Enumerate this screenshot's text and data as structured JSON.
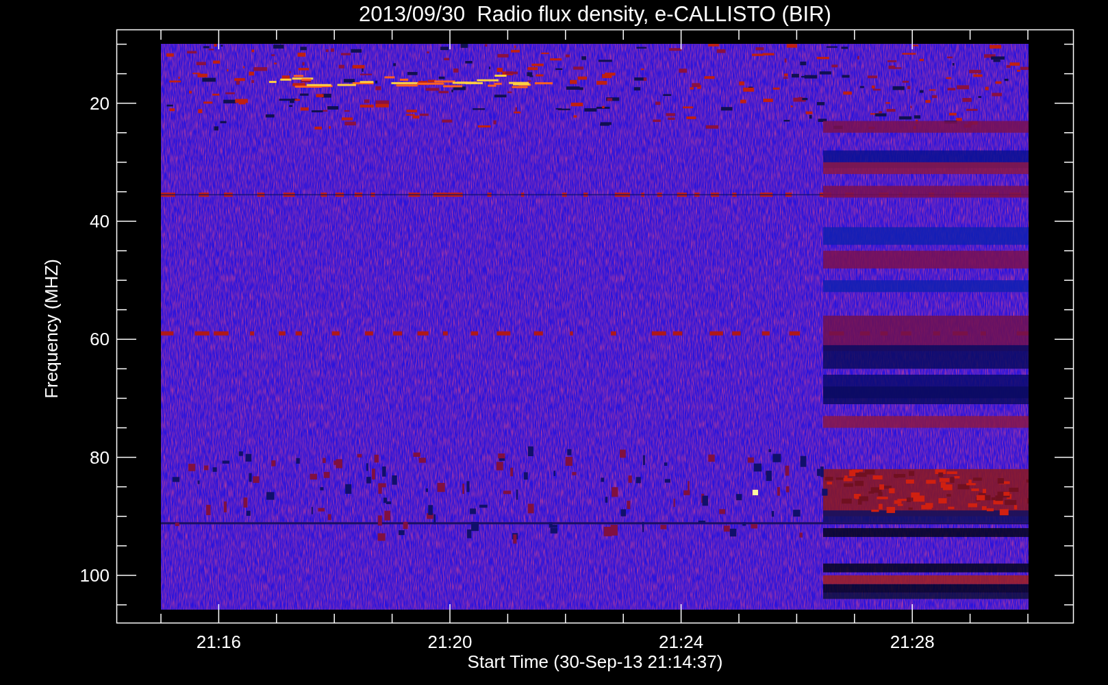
{
  "title": "2013/09/30  Radio flux density, e-CALLISTO (BIR)",
  "y_axis": {
    "label": "Frequency (MHZ)",
    "ticks": [
      "20",
      "40",
      "60",
      "80",
      "100"
    ]
  },
  "x_axis": {
    "label": "Start Time (30-Sep-13 21:14:37)",
    "ticks": [
      "21:16",
      "21:20",
      "21:24",
      "21:28"
    ]
  }
}
